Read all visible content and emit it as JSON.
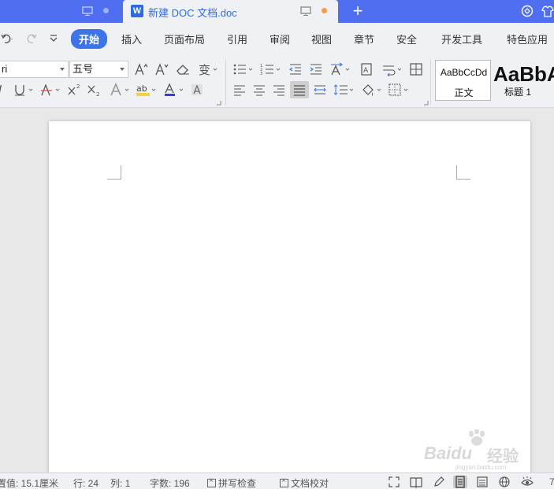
{
  "titlebar": {
    "tabs": [
      {
        "label": "",
        "active": false
      },
      {
        "label": "新建 DOC 文档.doc",
        "active": true,
        "app_icon": "W"
      }
    ],
    "new_tab": "+"
  },
  "quick_access": [
    "undo-icon",
    "redo-icon",
    "customize-icon"
  ],
  "menu": {
    "items": [
      "开始",
      "插入",
      "页面布局",
      "引用",
      "审阅",
      "视图",
      "章节",
      "安全",
      "开发工具",
      "特色应用"
    ],
    "active": "开始"
  },
  "toolbar": {
    "font_name": "ri",
    "font_size": "五号",
    "styles": [
      {
        "sample": "AaBbCcDd",
        "name": "正文"
      },
      {
        "sample": "AaBbA",
        "name": "标题 1"
      }
    ]
  },
  "document": {
    "watermark": {
      "text": "Baidu",
      "cn": "经验",
      "url": "jingyan.baidu.com"
    }
  },
  "statusbar": {
    "setting": "置值: 15.1厘米",
    "row": "行: 24",
    "col": "列: 1",
    "words": "字数: 196",
    "spell_check": "拼写检查",
    "proofread": "文档校对",
    "zoom": "7"
  },
  "colors": {
    "title_blue": "#4f6ff0",
    "active_tab_text": "#2d6be4",
    "active_menu": "#3d75e8"
  }
}
